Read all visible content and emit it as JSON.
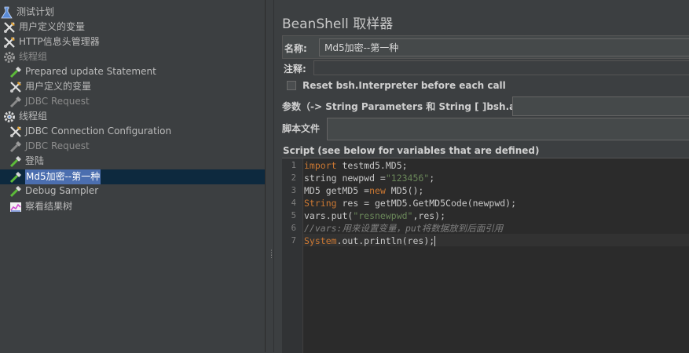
{
  "tree": {
    "items": [
      {
        "label": "测试计划",
        "icon": "flask-icon"
      },
      {
        "label": "用户定义的变量",
        "icon": "wrench-icon"
      },
      {
        "label": "HTTP信息头管理器",
        "icon": "wrench-icon"
      },
      {
        "label": "线程组",
        "icon": "gear-icon"
      },
      {
        "label": "Prepared  update   Statement",
        "icon": "pipette-icon"
      },
      {
        "label": "用户定义的变量",
        "icon": "wrench-icon"
      },
      {
        "label": "JDBC Request",
        "icon": "pipette-icon"
      },
      {
        "label": "线程组",
        "icon": "gear-icon"
      },
      {
        "label": "JDBC Connection Configuration",
        "icon": "wrench-icon"
      },
      {
        "label": "JDBC Request",
        "icon": "pipette-icon"
      },
      {
        "label": "登陆",
        "icon": "pipette-icon"
      },
      {
        "label": "Md5加密--第一种",
        "icon": "pipette-icon"
      },
      {
        "label": "Debug Sampler",
        "icon": "pipette-icon"
      },
      {
        "label": "察看结果树",
        "icon": "chart-icon"
      }
    ]
  },
  "panel": {
    "title": "BeanShell 取样器",
    "name_label": "名称:",
    "name_value": "Md5加密--第一种",
    "comment_label": "注释:",
    "reset_label": "Reset bsh.Interpreter before each call",
    "params_label": "参数（-> String Parameters 和 String [ ]bsh.args）",
    "file_label": "脚本文件",
    "script_label": "Script (see below for variables that are defined)"
  },
  "editor": {
    "line_numbers": [
      "1",
      "2",
      "3",
      "4",
      "5",
      "6",
      "7"
    ],
    "l1": {
      "kw": "import",
      "rest": " testmd5.MD5;"
    },
    "l2": {
      "a": "string newpwd =",
      "str": "\"123456\"",
      "b": ";"
    },
    "l3": {
      "a": "MD5 getMD5 =",
      "kw": "new",
      "b": " MD5();"
    },
    "l4": {
      "kw": "String",
      "rest": " res = getMD5.GetMD5Code(newpwd);"
    },
    "l5": {
      "a": "vars.put(",
      "str": "\"resnewpwd\"",
      "b": ",res);"
    },
    "l6": {
      "cm": "//vars:用来设置变量，put将数据放到后面引用"
    },
    "l7": {
      "kw": "System",
      "rest": ".out.println(res);"
    }
  },
  "colors": {
    "selection": "#4b6eaf",
    "keyword": "#cc7832",
    "string": "#6a8759",
    "comment": "#808080"
  }
}
